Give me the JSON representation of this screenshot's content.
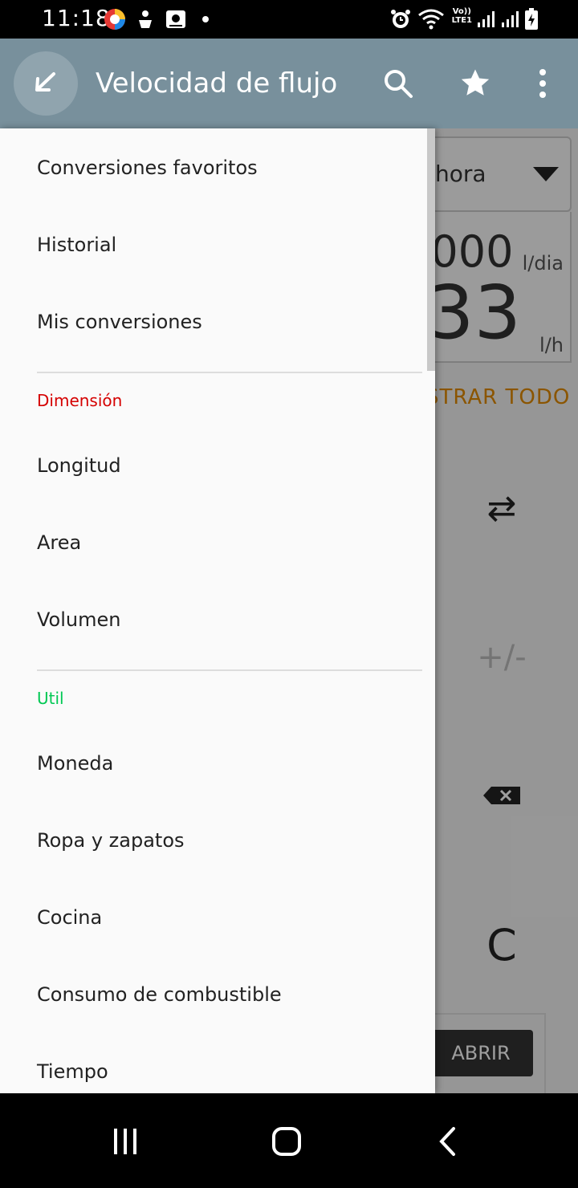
{
  "status_bar": {
    "time": "11:18",
    "network_label_top": "Vo))",
    "network_label_bottom": "LTE1",
    "icons": [
      "app-notification-icon",
      "download-icon",
      "photo-icon",
      "dot-icon",
      "alarm-icon",
      "wifi-icon",
      "signal-icon",
      "signal-icon",
      "battery-charging-icon"
    ]
  },
  "app_bar": {
    "title": "Velocidad de flujo",
    "icons": [
      "back-arrow-icon",
      "search-icon",
      "star-icon",
      "more-vert-icon"
    ]
  },
  "background": {
    "unit_select": "hora",
    "value1": "0000",
    "unit1": "l/dia",
    "value2": "33",
    "unit2": "l/h",
    "show_all": "STRAR TODO",
    "swap_key": "⇄",
    "sign_key": "+/-",
    "clear_key": "C",
    "open_button": "ABRIR"
  },
  "drawer": {
    "top_items": [
      "Conversiones favoritos",
      "Historial",
      "Mis conversiones"
    ],
    "sections": [
      {
        "title": "Dimensión",
        "color": "#d50000",
        "items": [
          "Longitud",
          "Area",
          "Volumen"
        ]
      },
      {
        "title": "Util",
        "color": "#00c853",
        "items": [
          "Moneda",
          "Ropa y zapatos",
          "Cocina",
          "Consumo de combustible",
          "Tiempo"
        ]
      }
    ]
  },
  "nav_bar": {
    "icons": [
      "recent-apps-icon",
      "home-icon",
      "back-icon"
    ]
  },
  "colors": {
    "app_bar": "#78909c",
    "accent_orange": "#e08a00"
  }
}
